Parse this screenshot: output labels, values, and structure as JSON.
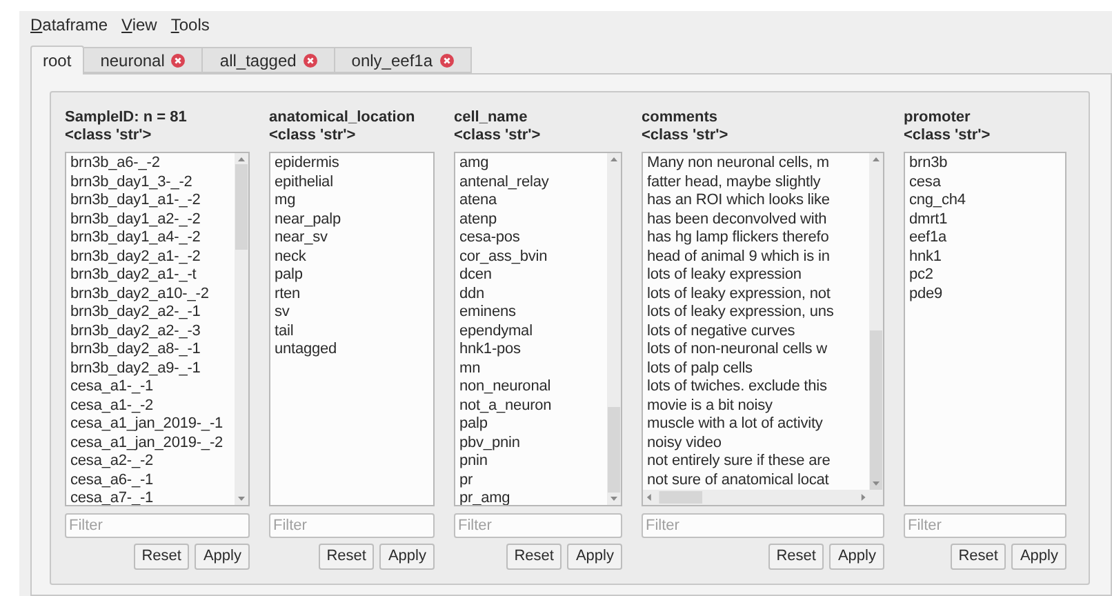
{
  "menu": [
    {
      "label": "Dataframe"
    },
    {
      "label": "View"
    },
    {
      "label": "Tools"
    }
  ],
  "tabs": [
    {
      "label": "root",
      "selected": true,
      "closable": false
    },
    {
      "label": "neuronal",
      "selected": false,
      "closable": true
    },
    {
      "label": "all_tagged",
      "selected": false,
      "closable": true
    },
    {
      "label": "only_eef1a",
      "selected": false,
      "closable": true
    }
  ],
  "columns": [
    {
      "title": "SampleID: n = 81",
      "type": "<class 'str'>",
      "vertical_scrollbar": true,
      "horizontal_scrollbar": false,
      "values": [
        "brn3b_a6-_-2",
        "brn3b_day1_3-_-2",
        "brn3b_day1_a1-_-2",
        "brn3b_day1_a2-_-2",
        "brn3b_day1_a4-_-2",
        "brn3b_day2_a1-_-2",
        "brn3b_day2_a1-_-t",
        "brn3b_day2_a10-_-2",
        "brn3b_day2_a2-_-1",
        "brn3b_day2_a2-_-3",
        "brn3b_day2_a8-_-1",
        "brn3b_day2_a9-_-1",
        "cesa_a1-_-1",
        "cesa_a1-_-2",
        "cesa_a1_jan_2019-_-1",
        "cesa_a1_jan_2019-_-2",
        "cesa_a2-_-2",
        "cesa_a6-_-1",
        "cesa_a7-_-1"
      ],
      "filter_placeholder": "Filter",
      "buttons": [
        "Reset",
        "Apply"
      ]
    },
    {
      "title": "anatomical_location",
      "type": "<class 'str'>",
      "vertical_scrollbar": false,
      "horizontal_scrollbar": false,
      "values": [
        "epidermis",
        "epithelial",
        "mg",
        "near_palp",
        "near_sv",
        "neck",
        "palp",
        "rten",
        "sv",
        "tail",
        "untagged"
      ],
      "filter_placeholder": "Filter",
      "buttons": [
        "Reset",
        "Apply"
      ]
    },
    {
      "title": "cell_name",
      "type": "<class 'str'>",
      "vertical_scrollbar": true,
      "horizontal_scrollbar": false,
      "values": [
        "amg",
        "antenal_relay",
        "atena",
        "atenp",
        "cesa-pos",
        "cor_ass_bvin",
        "dcen",
        "ddn",
        "eminens",
        "ependymal",
        "hnk1-pos",
        "mn",
        "non_neuronal",
        "not_a_neuron",
        "palp",
        "pbv_pnin",
        "pnin",
        "pr",
        "pr_amg"
      ],
      "filter_placeholder": "Filter",
      "buttons": [
        "Reset",
        "Apply"
      ]
    },
    {
      "title": "comments",
      "type": "<class 'str'>",
      "vertical_scrollbar": true,
      "horizontal_scrollbar": true,
      "values": [
        "Many non neuronal cells, m",
        "fatter head, maybe slightly",
        "has an ROI which looks like",
        "has been deconvolved with",
        "has hg lamp flickers therefo",
        "head of animal 9 which is in",
        "lots of leaky expression",
        "lots of leaky expression, not",
        "lots of leaky expression, uns",
        "lots of negative curves",
        "lots of non-neuronal cells w",
        "lots of palp cells",
        "lots of twiches. exclude this",
        "movie is a bit noisy",
        "muscle with a lot of activity",
        "noisy video",
        "not entirely sure if these are",
        "not sure of anatomical locat"
      ],
      "filter_placeholder": "Filter",
      "buttons": [
        "Reset",
        "Apply"
      ]
    },
    {
      "title": "promoter",
      "type": "<class 'str'>",
      "vertical_scrollbar": false,
      "horizontal_scrollbar": false,
      "values": [
        "brn3b",
        "cesa",
        "cng_ch4",
        "dmrt1",
        "eef1a",
        "hnk1",
        "pc2",
        "pde9"
      ],
      "filter_placeholder": "Filter",
      "buttons": [
        "Reset",
        "Apply"
      ]
    }
  ]
}
